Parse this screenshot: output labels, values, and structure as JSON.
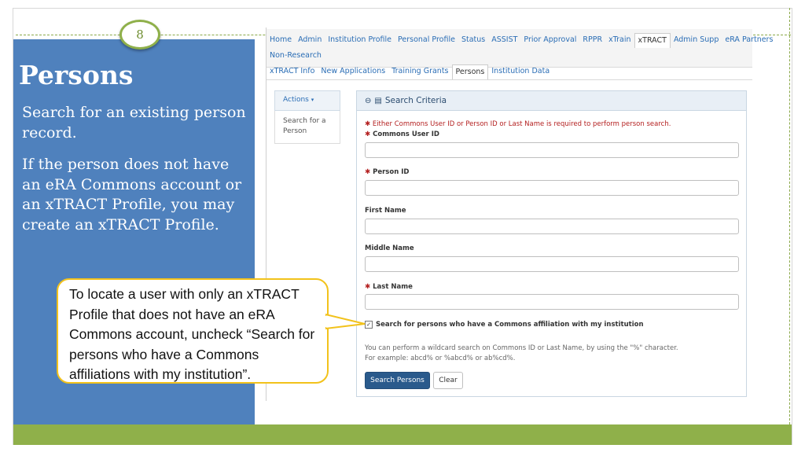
{
  "slide": {
    "number": "8",
    "title": "Persons",
    "paragraph1": "Search for an existing person record.",
    "paragraph2": "If the person does not have an eRA Commons account or an xTRACT Profile, you may create an xTRACT Profile.",
    "callout": "To locate a user with only an xTRACT Profile that does not have an eRA Commons account, uncheck “Search for persons who have a Commons affiliations with my institution”."
  },
  "topnav": {
    "row1": [
      "Home",
      "Admin",
      "Institution Profile",
      "Personal Profile",
      "Status",
      "ASSIST",
      "Prior Approval",
      "RPPR",
      "xTrain",
      "xTRACT",
      "Admin Supp",
      "eRA Partners"
    ],
    "row2": [
      "Non-Research"
    ],
    "active": "xTRACT"
  },
  "subnav": {
    "items": [
      "xTRACT Info",
      "New Applications",
      "Training Grants",
      "Persons",
      "Institution Data"
    ],
    "active": "Persons"
  },
  "sidebar": {
    "actions_label": "Actions",
    "link": "Search for a Person"
  },
  "search": {
    "header": "Search Criteria",
    "required_note": "Either Commons User ID or Person ID or Last Name is required to perform person search.",
    "fields": [
      {
        "label": "Commons User ID",
        "required": true,
        "value": ""
      },
      {
        "label": "Person ID",
        "required": true,
        "value": ""
      },
      {
        "label": "First Name",
        "required": false,
        "value": ""
      },
      {
        "label": "Middle Name",
        "required": false,
        "value": ""
      },
      {
        "label": "Last Name",
        "required": true,
        "value": ""
      }
    ],
    "checkbox_label": "Search for persons who have a Commons affiliation with my institution",
    "checkbox_checked": true,
    "hint1": "You can perform a wildcard search on Commons ID or Last Name, by using the \"%\" character.",
    "hint2": "For example: abcd% or %abcd% or ab%cd%.",
    "search_button": "Search Persons",
    "clear_button": "Clear"
  },
  "colors": {
    "panel_blue": "#4f81bd",
    "accent_green": "#8fb04a",
    "callout_border": "#f2c21b",
    "primary_button": "#2a5a8c",
    "required_red": "#b42020"
  }
}
